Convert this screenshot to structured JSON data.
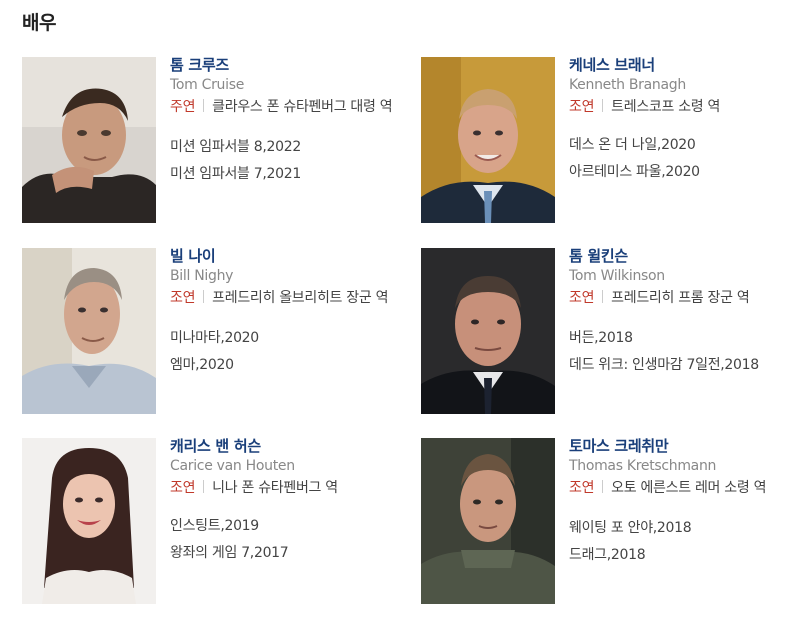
{
  "section": {
    "title": "배우"
  },
  "actors": [
    {
      "name_ko": "톰 크루즈",
      "name_en": "Tom Cruise",
      "role_type": "주연",
      "role": "클라우스 폰 슈타펜버그 대령 역",
      "works": [
        "미션 임파서블 8,2022",
        "미션 임파서블 7,2021"
      ]
    },
    {
      "name_ko": "케네스 브래너",
      "name_en": "Kenneth Branagh",
      "role_type": "조연",
      "role": "트레스코프 소령 역",
      "works": [
        "데스 온 더 나일,2020",
        "아르테미스 파울,2020"
      ]
    },
    {
      "name_ko": "빌 나이",
      "name_en": "Bill Nighy",
      "role_type": "조연",
      "role": "프레드리히 올브리히트 장군 역",
      "works": [
        "미나마타,2020",
        "엠마,2020"
      ]
    },
    {
      "name_ko": "톰 윌킨슨",
      "name_en": "Tom Wilkinson",
      "role_type": "조연",
      "role": "프레드리히 프롬 장군 역",
      "works": [
        "버든,2018",
        "데드 위크: 인생마감 7일전,2018"
      ]
    },
    {
      "name_ko": "캐리스 밴 허슨",
      "name_en": "Carice van Houten",
      "role_type": "조연",
      "role": "니나 폰 슈타펜버그 역",
      "works": [
        "인스팅트,2019",
        "왕좌의 게임 7,2017"
      ]
    },
    {
      "name_ko": "토마스 크레취만",
      "name_en": "Thomas Kretschmann",
      "role_type": "조연",
      "role": "오토 에른스트 레머 소령 역",
      "works": [
        "웨이팅 포 안야,2018",
        "드래그,2018"
      ]
    }
  ]
}
